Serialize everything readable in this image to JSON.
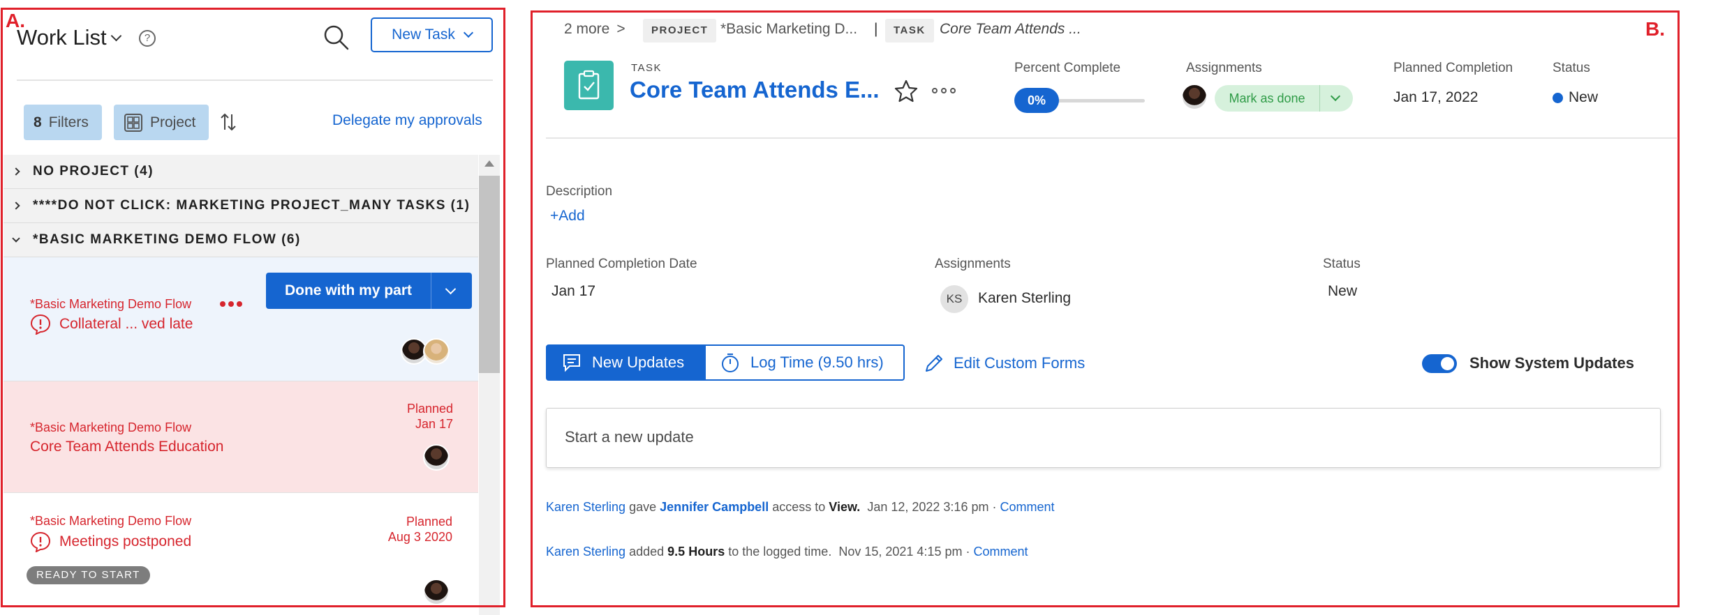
{
  "annotations": {
    "left_label": "A.",
    "right_label": "B."
  },
  "worklist": {
    "title": "Work List",
    "help": "?",
    "new_task": "New Task",
    "filters_count": "8",
    "filters_label": "Filters",
    "project_label": "Project",
    "delegate": "Delegate my approvals"
  },
  "groups": [
    {
      "label": "NO PROJECT (4)"
    },
    {
      "label": "****DO NOT CLICK: MARKETING PROJECT_MANY TASKS (1)"
    },
    {
      "label": "*BASIC MARKETING DEMO FLOW (6)"
    }
  ],
  "cards": [
    {
      "project": "*Basic Marketing Demo Flow",
      "name": "Collateral ... ved late",
      "action": "Done with my part"
    },
    {
      "project": "*Basic Marketing Demo Flow",
      "name": "Core Team Attends Education",
      "planned_label": "Planned",
      "planned_date": "Jan 17"
    },
    {
      "project": "*Basic Marketing Demo Flow",
      "name": "Meetings postponed",
      "planned_label": "Planned",
      "planned_date": "Aug 3 2020",
      "badge": "READY TO START"
    }
  ],
  "detail": {
    "breadcrumb": {
      "more": "2 more",
      "sep": ">",
      "project_tag": "PROJECT",
      "project_name": "*Basic Marketing D...",
      "divider": "|",
      "task_tag": "TASK",
      "task_name": "Core Team Attends ..."
    },
    "task_kind": "TASK",
    "title": "Core Team Attends E...",
    "percent_label": "Percent Complete",
    "percent_value": "0%",
    "assignments_label": "Assignments",
    "mark_done": "Mark as done",
    "planned_label": "Planned Completion",
    "planned_value": "Jan 17, 2022",
    "status_label": "Status",
    "status_value": "New",
    "description_label": "Description",
    "add_link": "+Add",
    "pcd_label": "Planned Completion Date",
    "pcd_value": "Jan 17",
    "assign_label": "Assignments",
    "assignee_initials": "KS",
    "assignee_name": "Karen Sterling",
    "status2_label": "Status",
    "status2_value": "New",
    "tab_updates": "New Updates",
    "tab_logtime": "Log Time (9.50 hrs)",
    "edit_forms": "Edit Custom Forms",
    "show_system": "Show System Updates",
    "update_placeholder": "Start a new update",
    "feed": [
      {
        "user": "Karen Sterling",
        "verb": "gave",
        "target": "Jennifer Campbell",
        "mid": "access to",
        "obj": "View.",
        "time": "Jan 12, 2022 3:16 pm",
        "dot": "·",
        "link": "Comment"
      },
      {
        "user": "Karen Sterling",
        "verb": "added",
        "obj": "9.5 Hours",
        "mid": "to the logged time.",
        "time": "Nov 15, 2021 4:15 pm",
        "dot": "·",
        "link": "Comment"
      }
    ]
  },
  "colors": {
    "accent": "#1565d0",
    "alert": "#d6252d",
    "frame": "#e0202a",
    "task_icon": "#3bb8ad",
    "success": "#2e9b46"
  },
  "icons": [
    "search-icon",
    "help-icon",
    "sort-icon",
    "project-grid-icon",
    "alert-icon",
    "star-icon",
    "more-icon",
    "clipboard-icon",
    "updates-icon",
    "timer-icon",
    "pencil-icon"
  ]
}
